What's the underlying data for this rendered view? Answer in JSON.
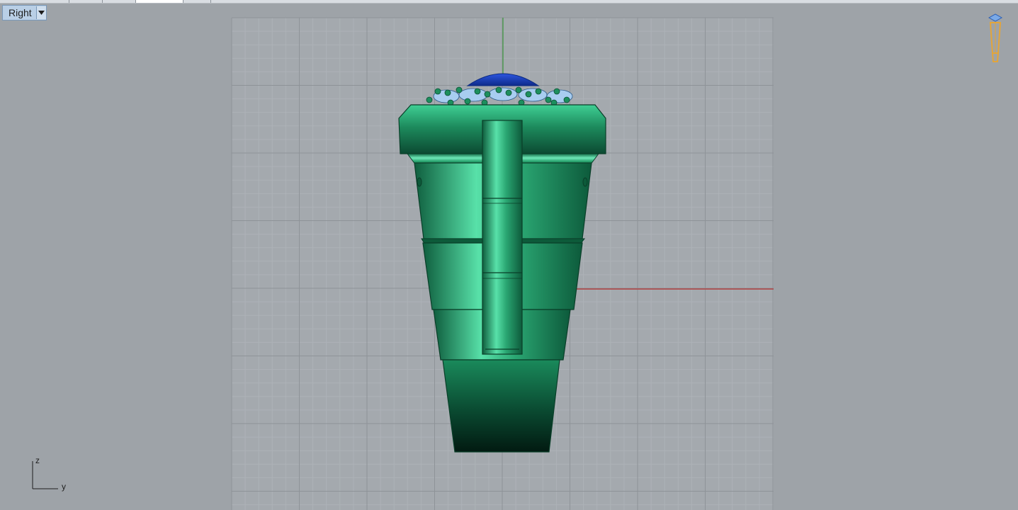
{
  "viewport": {
    "label": "Right",
    "dropdown_icon": "caret-down-icon",
    "axis_labels": {
      "vertical": "z",
      "horizontal": "y"
    }
  },
  "scene": {
    "object": "ring-model",
    "colors": {
      "background": "#9ea3a8",
      "grid_minor": "#a7acb1",
      "grid_major": "#8c9196",
      "axis_vertical": "#3f9a3f",
      "axis_horizontal": "#b04040",
      "metal": "#1f8a5c",
      "gem_center": "#1e40b8",
      "gem_side": "#9ec3ea"
    }
  },
  "icons": {
    "view_cube": "ring-thumbnail-icon"
  }
}
